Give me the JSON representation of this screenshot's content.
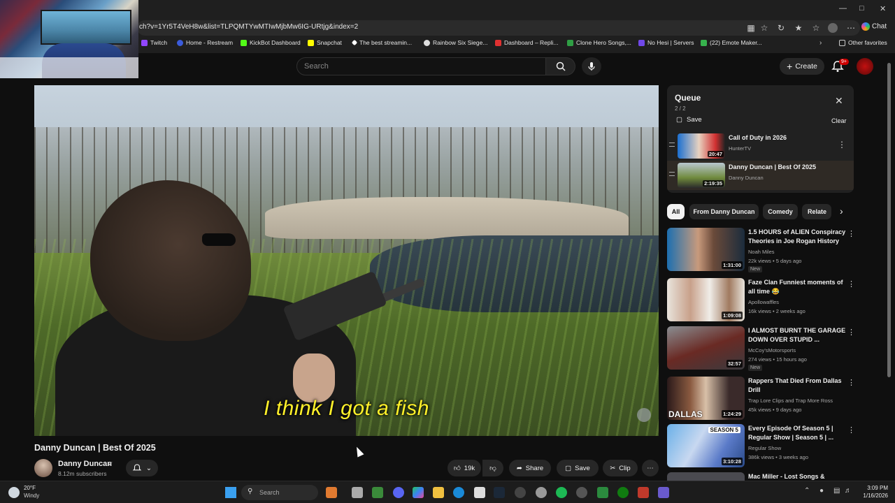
{
  "browser": {
    "url": "ch?v=1Yr5T4VeH8w&list=TLPQMTYwMTIwMjbMw6IG-URtjg&index=2",
    "chat_label": "Chat",
    "bookmarks": [
      {
        "label": "Twitch",
        "color": "#9146ff"
      },
      {
        "label": "Home - Restream",
        "color": "#3b5bdb"
      },
      {
        "label": "KickBot Dashboard",
        "color": "#53fc18"
      },
      {
        "label": "Snapchat",
        "color": "#fffc00"
      },
      {
        "label": "The best streamin...",
        "color": "#ffffff"
      },
      {
        "label": "Rainbow Six Siege...",
        "color": "#dddddd"
      },
      {
        "label": "Dashboard – Repli...",
        "color": "#e03131"
      },
      {
        "label": "Clone Hero Songs,...",
        "color": "#2f9e44"
      },
      {
        "label": "No Hesi | Servers",
        "color": "#7048e8"
      },
      {
        "label": "(22) Emote Maker...",
        "color": "#37b24d"
      }
    ],
    "other_favorites": "Other favorites"
  },
  "youtube": {
    "search_placeholder": "Search",
    "create_label": "Create",
    "notification_count": "9+"
  },
  "video": {
    "caption": "I think I got a fish",
    "title": "Danny Duncan | Best Of 2025",
    "channel": "Danny Duncan",
    "subscribers": "8.12m subscribers",
    "likes": "19k",
    "share_label": "Share",
    "save_label": "Save",
    "clip_label": "Clip"
  },
  "queue": {
    "title": "Queue",
    "count": "2 / 2",
    "save_label": "Save",
    "clear_label": "Clear",
    "items": [
      {
        "title": "Call of Duty in 2026",
        "channel": "HunterTV",
        "duration": "20:47"
      },
      {
        "title": "Danny Duncan | Best Of 2025",
        "channel": "Danny Duncan",
        "duration": "2:19:35"
      }
    ]
  },
  "chips": [
    "All",
    "From Danny Duncan",
    "Comedy",
    "Relate"
  ],
  "recommended": [
    {
      "title_line1": "1.5 HOURS of ALIEN Conspiracy",
      "title_line2": "Theories in Joe Rogan History",
      "channel": "Noah Miles",
      "meta": "22k views • 5 days ago",
      "duration": "1:31:00",
      "badge": "New"
    },
    {
      "title_line1": "Faze Clan Funniest moments of",
      "title_line2": "all time 😂",
      "channel": "Apollowaffles",
      "meta": "16k views • 2 weeks ago",
      "duration": "1:09:08",
      "badge": ""
    },
    {
      "title_line1": "I ALMOST BURNT THE GARAGE",
      "title_line2": "DOWN OVER STUPID ...",
      "channel": "McCoy'sMotorsports",
      "meta": "274 views • 15 hours ago",
      "duration": "32:57",
      "badge": "New"
    },
    {
      "title_line1": "Rappers That Died From Dallas",
      "title_line2": "Drill",
      "channel": "Trap Lore Clips and Trap More Ross",
      "meta": "45k views • 9 days ago",
      "duration": "1:24:29",
      "badge": "",
      "thumb_text": "DALLAS"
    },
    {
      "title_line1": "Every Episode Of Season 5 |",
      "title_line2": "Regular Show | Season 5 | ...",
      "channel": "Regular Show",
      "meta": "386k views • 3 weeks ago",
      "duration": "3:10:28",
      "badge": "",
      "thumb_text": "SEASON 5"
    },
    {
      "title_line1": "Mac Miller - Lost Songs &",
      "title_line2": "",
      "channel": "",
      "meta": "",
      "duration": "",
      "badge": ""
    }
  ],
  "taskbar": {
    "temp": "20°F",
    "weather": "Windy",
    "search_placeholder": "Search",
    "time": "3:09 PM",
    "date": "1/16/2026"
  }
}
